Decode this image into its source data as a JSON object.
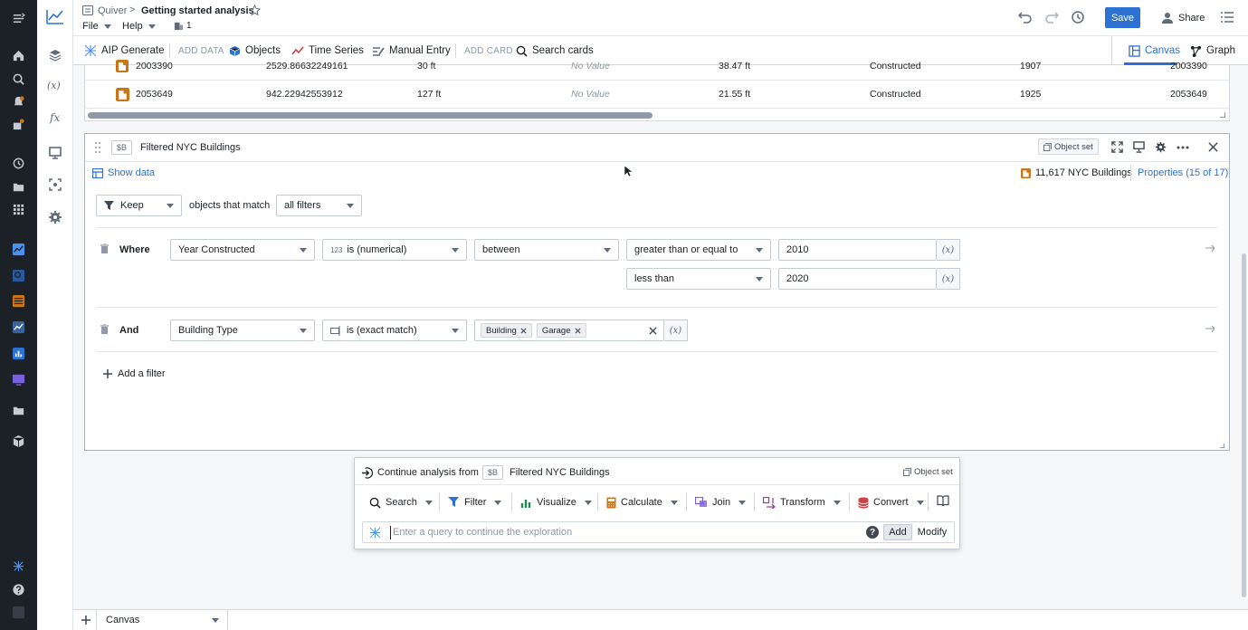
{
  "header": {
    "breadcrumb_parent": "Quiver",
    "breadcrumb_sep": ">",
    "title": "Getting started analysis",
    "menu_file": "File",
    "menu_help": "Help",
    "member_count": "1",
    "save_label": "Save",
    "share_label": "Share"
  },
  "toolbar": {
    "aip_generate": "AIP Generate",
    "add_data": "ADD DATA",
    "objects": "Objects",
    "time_series": "Time Series",
    "manual_entry": "Manual Entry",
    "add_card": "ADD CARD",
    "search_cards": "Search cards",
    "canvas": "Canvas",
    "graph": "Graph"
  },
  "table": {
    "rows": [
      {
        "id": "2003390",
        "area": "2529.86632249161",
        "height": "30 ft",
        "novalue": "No Value",
        "dist": "38.47 ft",
        "status": "Constructed",
        "year": "1907",
        "id2": "2003390"
      },
      {
        "id": "2053649",
        "area": "942.22942553912",
        "height": "127 ft",
        "novalue": "No Value",
        "dist": "21.55 ft",
        "status": "Constructed",
        "year": "1925",
        "id2": "2053649"
      }
    ]
  },
  "filter_card": {
    "var_tag": "$B",
    "title": "Filtered NYC Buildings",
    "object_set_label": "Object set",
    "show_data": "Show data",
    "count_label": "11,617 NYC Buildings",
    "properties_label": "Properties (15 of 17)",
    "keep": "Keep",
    "objects_that_match": "objects that match",
    "all_filters": "all filters",
    "where": "Where",
    "and": "And",
    "f1_property": "Year Constructed",
    "f1_op_prefix": "123",
    "f1_op": "is (numerical)",
    "f1_range": "between",
    "f1_cmp1": "greater than or equal to",
    "f1_val1": "2010",
    "f1_cmp2": "less than",
    "f1_val2": "2020",
    "f2_property": "Building Type",
    "f2_op": "is (exact match)",
    "f2_tags": [
      "Building",
      "Garage"
    ],
    "var_symbol": "(x)",
    "add_filter": "Add a filter"
  },
  "continue": {
    "label": "Continue analysis from",
    "var_tag": "$B",
    "source": "Filtered NYC Buildings",
    "object_set_label": "Object set",
    "buttons": [
      "Search",
      "Filter",
      "Visualize",
      "Calculate",
      "Join",
      "Transform",
      "Convert"
    ],
    "query_placeholder": "Enter a query to continue the exploration",
    "add_label": "Add",
    "modify_label": "Modify",
    "help_symbol": "?"
  },
  "bottom": {
    "tab_label": "Canvas"
  },
  "colors": {
    "accent": "#2d72d2",
    "rail_bg": "#1c2127",
    "orange": "#c87619"
  }
}
